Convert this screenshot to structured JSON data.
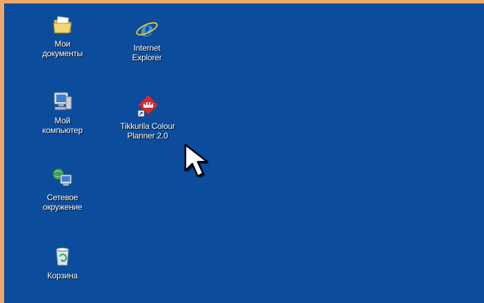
{
  "desktop": {
    "background_color": "#0b4d9c",
    "frame_color": "#f0a868",
    "icons": [
      {
        "name": "my-documents",
        "label": "Мои\nдокументы",
        "icon": "folder-documents-icon"
      },
      {
        "name": "internet-explorer",
        "label": "Internet\nExplorer",
        "icon": "internet-explorer-icon"
      },
      {
        "name": "tikkurila",
        "label": "Tikkurila Colour\nPlanner 2.0",
        "icon": "tikkurila-shortcut-icon"
      },
      {
        "name": "my-computer",
        "label": "Мой\nкомпьютер",
        "icon": "computer-icon"
      },
      {
        "name": "network",
        "label": "Сетевое\nокружение",
        "icon": "network-icon"
      },
      {
        "name": "recycle-bin",
        "label": "Корзина",
        "icon": "recycle-bin-icon"
      }
    ]
  },
  "cursor": {
    "icon": "arrow-cursor-icon"
  }
}
